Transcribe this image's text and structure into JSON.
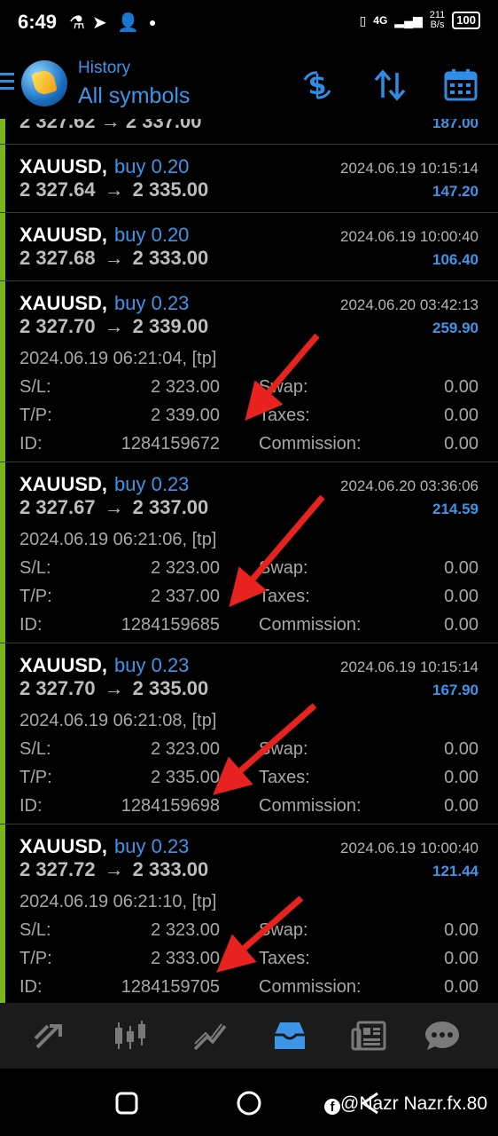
{
  "status_bar": {
    "time": "6:49",
    "network": "4G",
    "speed_value": "211",
    "speed_unit": "B/s",
    "battery": "100"
  },
  "header": {
    "subtitle": "History",
    "title": "All symbols"
  },
  "partial_top": {
    "prices": "2 327.62 → 2 337.00",
    "profit": "187.00"
  },
  "trades": [
    {
      "symbol": "XAUUSD,",
      "side": "buy 0.20",
      "close_time": "2024.06.19 10:15:14",
      "open_price": "2 327.64",
      "close_price": "2 335.00",
      "profit": "147.20"
    },
    {
      "symbol": "XAUUSD,",
      "side": "buy 0.20",
      "close_time": "2024.06.19 10:00:40",
      "open_price": "2 327.68",
      "close_price": "2 333.00",
      "profit": "106.40"
    },
    {
      "symbol": "XAUUSD,",
      "side": "buy 0.23",
      "close_time": "2024.06.20 03:42:13",
      "open_price": "2 327.70",
      "close_price": "2 339.00",
      "profit": "259.90",
      "open_time": "2024.06.19 06:21:04, [tp]",
      "sl": "2 323.00",
      "tp": "2 339.00",
      "id": "1284159672",
      "swap": "0.00",
      "taxes": "0.00",
      "commission": "0.00"
    },
    {
      "symbol": "XAUUSD,",
      "side": "buy 0.23",
      "close_time": "2024.06.20 03:36:06",
      "open_price": "2 327.67",
      "close_price": "2 337.00",
      "profit": "214.59",
      "open_time": "2024.06.19 06:21:06, [tp]",
      "sl": "2 323.00",
      "tp": "2 337.00",
      "id": "1284159685",
      "swap": "0.00",
      "taxes": "0.00",
      "commission": "0.00"
    },
    {
      "symbol": "XAUUSD,",
      "side": "buy 0.23",
      "close_time": "2024.06.19 10:15:14",
      "open_price": "2 327.70",
      "close_price": "2 335.00",
      "profit": "167.90",
      "open_time": "2024.06.19 06:21:08, [tp]",
      "sl": "2 323.00",
      "tp": "2 335.00",
      "id": "1284159698",
      "swap": "0.00",
      "taxes": "0.00",
      "commission": "0.00"
    },
    {
      "symbol": "XAUUSD,",
      "side": "buy 0.23",
      "close_time": "2024.06.19 10:00:40",
      "open_price": "2 327.72",
      "close_price": "2 333.00",
      "profit": "121.44",
      "open_time": "2024.06.19 06:21:10, [tp]",
      "sl": "2 323.00",
      "tp": "2 333.00",
      "id": "1284159705",
      "swap": "0.00",
      "taxes": "0.00",
      "commission": "0.00"
    }
  ],
  "labels": {
    "sl": "S/L:",
    "tp": "T/P:",
    "id": "ID:",
    "swap": "Swap:",
    "taxes": "Taxes:",
    "commission": "Commission:",
    "arrow_sep": "→"
  },
  "bottom_nav": [
    "trade-icon",
    "chart-icon",
    "analytics-icon",
    "history-icon",
    "news-icon",
    "chat-icon"
  ],
  "watermark": "@Nazr Nazr.fx.80",
  "colors": {
    "accent": "#3d95e8",
    "buy_bar": "#7ab61a",
    "annotation_arrow": "#e8231f"
  }
}
